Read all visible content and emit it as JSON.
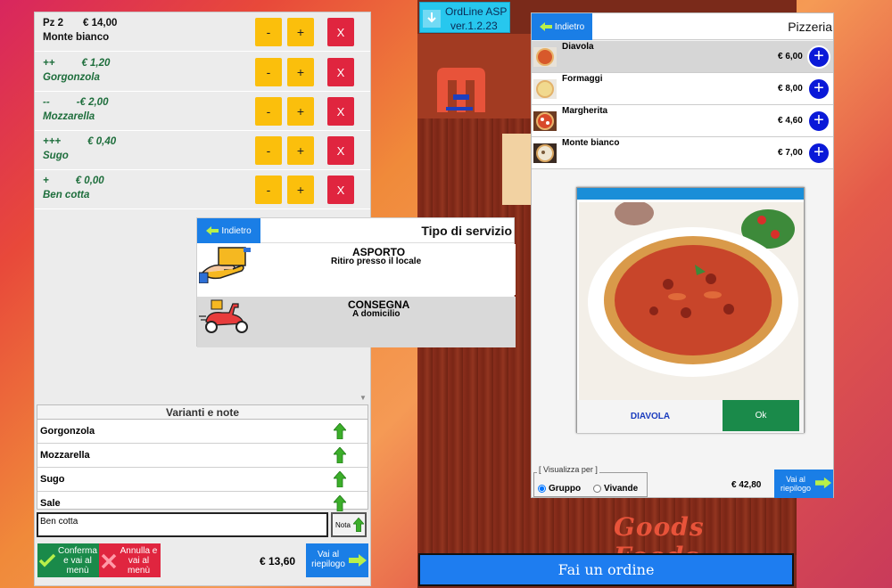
{
  "colors": {
    "accent_blue": "#1a7ee6",
    "confirm_green": "#1a8a4a",
    "delete_red": "#e0253f",
    "qty_yellow": "#fbbf0c",
    "add_circle_blue": "#0a19d8",
    "version_cyan": "#27c7ee"
  },
  "order_items": [
    {
      "type": "main",
      "line1_a": "Pz 2",
      "line1_b": "€ 14,00",
      "line2": "Monte bianco"
    },
    {
      "type": "mod",
      "line1_a": "++",
      "line1_b": "€ 1,20",
      "line2": "Gorgonzola"
    },
    {
      "type": "mod",
      "line1_a": "--",
      "line1_b": "-€ 2,00",
      "line2": "Mozzarella"
    },
    {
      "type": "mod",
      "line1_a": "+++",
      "line1_b": "€ 0,40",
      "line2": "Sugo"
    },
    {
      "type": "mod",
      "line1_a": "+",
      "line1_b": "€ 0,00",
      "line2": "Ben cotta"
    }
  ],
  "item_buttons": {
    "minus": "-",
    "plus": "+",
    "delete": "X"
  },
  "variants": {
    "title": "Varianti e note",
    "items": [
      "Gorgonzola",
      "Mozzarella",
      "Sugo",
      "Sale"
    ]
  },
  "note": {
    "value": "Ben cotta",
    "button_label": "Nota"
  },
  "left_footer": {
    "confirm_label": "Conferma e vai al menù",
    "cancel_label": "Annulla e vai al menù",
    "total": "€ 13,60",
    "recap_label": "Vai al riepilogo"
  },
  "app": {
    "version_line1": "OrdLine ASP",
    "version_line2": "ver.1.2.23",
    "brand": "Goods Foods",
    "order_button": "Fai un ordine"
  },
  "service_modal": {
    "back_label": "Indietro",
    "title": "Tipo di servizio",
    "options": [
      {
        "title": "ASPORTO",
        "subtitle": "Ritiro presso il locale",
        "icon": "takeaway-hand-icon"
      },
      {
        "title": "CONSEGNA",
        "subtitle": "A domicilio",
        "icon": "delivery-scooter-icon"
      }
    ]
  },
  "menu": {
    "back_label": "Indietro",
    "category": "Pizzeria",
    "products": [
      {
        "name": "Diavola",
        "price": "€ 6,00"
      },
      {
        "name": "Formaggi",
        "price": "€ 8,00"
      },
      {
        "name": "Margherita",
        "price": "€ 4,60"
      },
      {
        "name": "Monte bianco",
        "price": "€ 7,00"
      }
    ],
    "add_label": "+",
    "view_by": {
      "legend": "[ Visualizza per ]",
      "options": [
        "Gruppo",
        "Vivande"
      ],
      "selected": "Gruppo"
    },
    "total": "€ 42,80",
    "recap_label": "Vai al riepilogo"
  },
  "popup": {
    "name": "DIAVOLA",
    "ok_label": "Ok"
  }
}
